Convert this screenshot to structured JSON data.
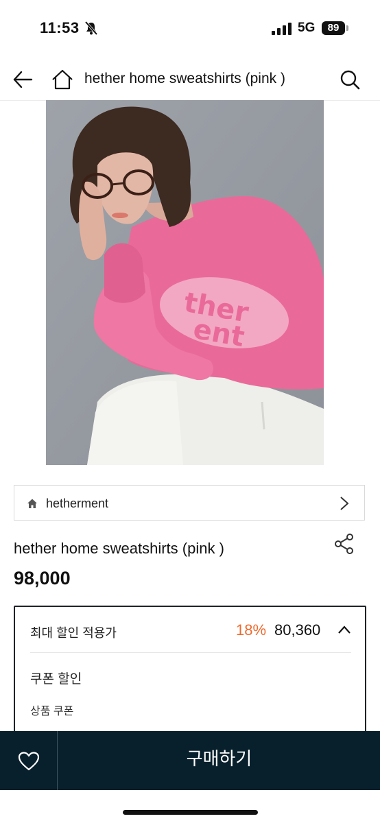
{
  "status_bar": {
    "time": "11:53",
    "network": "5G",
    "battery": "89",
    "icons": [
      "bell-slash-icon",
      "signal-icon",
      "battery-icon"
    ]
  },
  "nav": {
    "title": "hether home sweatshirts (pink )",
    "icons": [
      "back-arrow-icon",
      "home-icon",
      "search-icon"
    ]
  },
  "product": {
    "image": "product-photo",
    "graphic_text": [
      "ther",
      "ent"
    ],
    "brand": "hetherment",
    "title": "hether home sweatshirts (pink )",
    "price": "98,000"
  },
  "discount": {
    "label": "최대 할인 적용가",
    "percent": "18%",
    "price": "80,360",
    "coupon_title": "쿠폰 할인",
    "coupon_item": "상품 쿠폰"
  },
  "bottom_bar": {
    "buy_label": "구매하기",
    "wishlist_icon": "heart-icon"
  },
  "colors": {
    "accent": "#ee6a2e",
    "bottom_bar": "#08202c",
    "sweatshirt": "#e96a99"
  }
}
